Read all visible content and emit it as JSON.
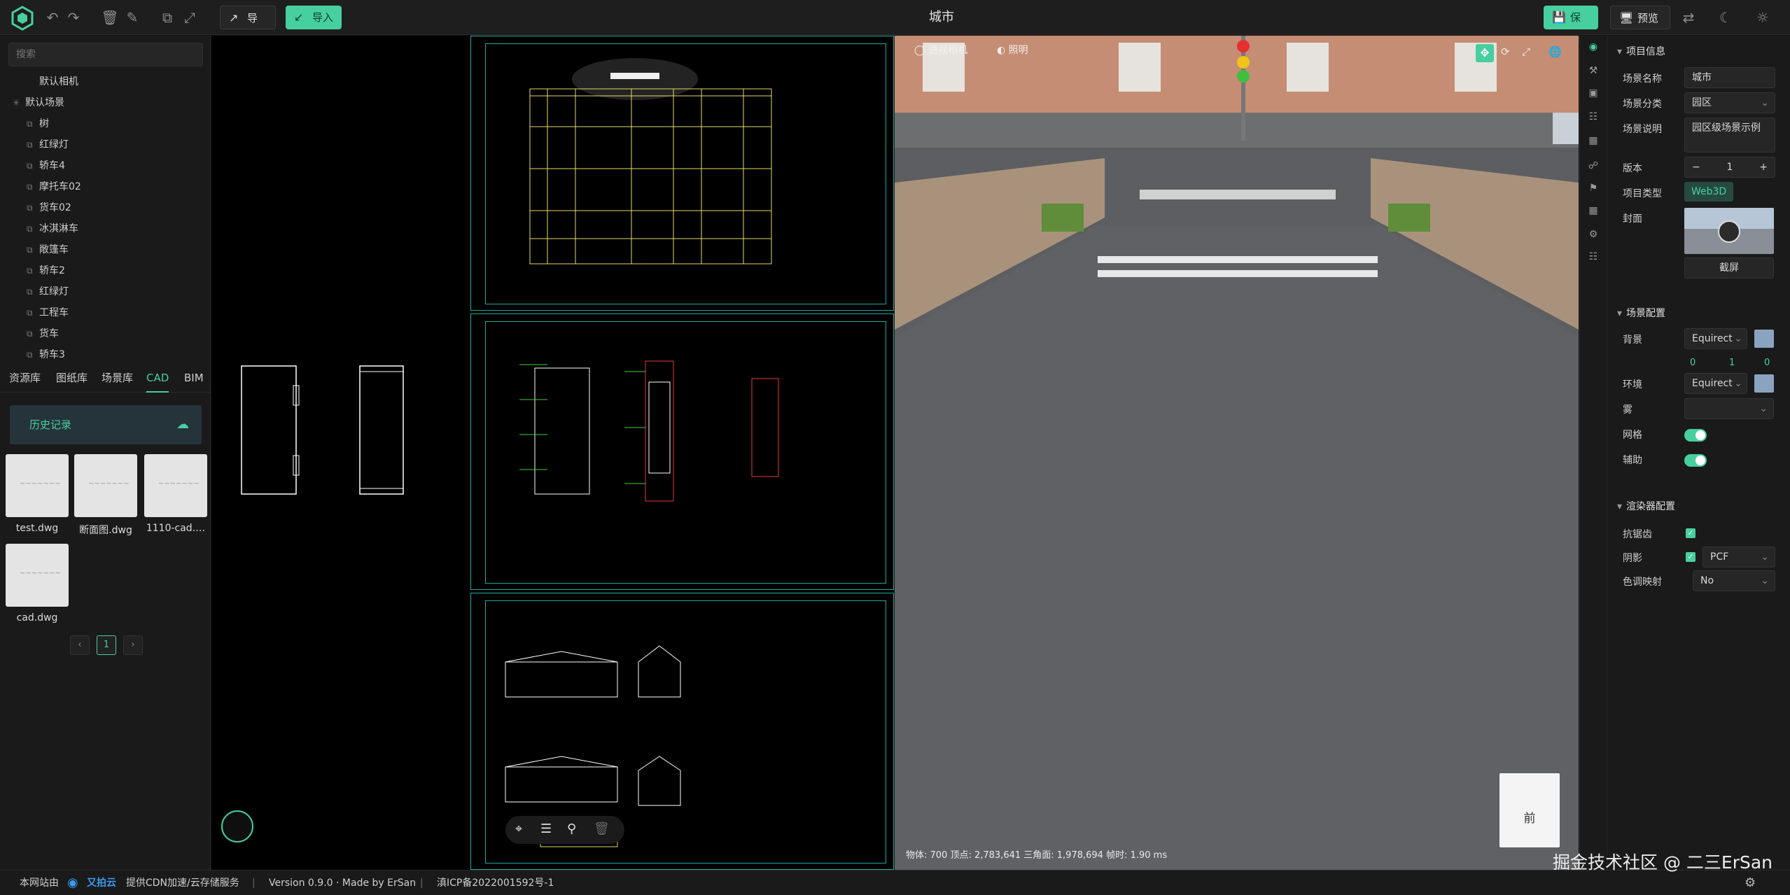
{
  "toolbar": {
    "export_label": "导出",
    "import_label": "导入",
    "title": "城市",
    "save_label": "保存",
    "preview_label": "预览"
  },
  "left": {
    "search_placeholder": "搜索",
    "tree": [
      "默认相机",
      "默认场景",
      "树",
      "红绿灯",
      "轿车4",
      "摩托车02",
      "货车02",
      "冰淇淋车",
      "敞篷车",
      "轿车2",
      "红绿灯",
      "工程车",
      "货车",
      "轿车3"
    ],
    "tabs": [
      "资源库",
      "图纸库",
      "场景库",
      "CAD",
      "BIM"
    ],
    "active_tab": "CAD",
    "history_label": "历史记录",
    "files": [
      "test.dwg",
      "断面图.dwg",
      "1110-cad.…",
      "cad.dwg"
    ],
    "page": "1"
  },
  "viewport": {
    "camera_label": "透视相机",
    "light_label": "照明",
    "status": "物体: 700  顶点: 2,783,641  三角面: 1,978,694  帧时: 1.90 ms",
    "cube_face": "前"
  },
  "right": {
    "section_project": "项目信息",
    "scene_name_label": "场景名称",
    "scene_name": "城市",
    "scene_cat_label": "场景分类",
    "scene_cat": "园区",
    "scene_desc_label": "场景说明",
    "scene_desc": "园区级场景示例",
    "version_label": "版本",
    "version": "1",
    "type_label": "项目类型",
    "type": "Web3D",
    "cover_label": "封面",
    "screenshot_label": "截屏",
    "section_scene": "场景配置",
    "bg_label": "背景",
    "bg_value": "Equirect",
    "bg_nums": [
      "0",
      "1",
      "0"
    ],
    "env_label": "环境",
    "env_value": "Equirect",
    "fog_label": "雾",
    "grid_label": "网格",
    "helper_label": "辅助",
    "section_render": "渲染器配置",
    "aa_label": "抗锯齿",
    "shadow_label": "阴影",
    "shadow_value": "PCF",
    "tonemap_label": "色调映射",
    "tonemap_value": "No"
  },
  "footer": {
    "site": "本网站由",
    "brand": "又拍云",
    "cdn": "提供CDN加速/云存储服务",
    "version": "Version 0.9.0 · Made by ErSan",
    "icp": "滇ICP备2022001592号-1"
  },
  "watermark": "掘金技术社区 @ 二三ErSan",
  "colors": {
    "accent": "#48cfa0",
    "cad_line": "#1fa9a0"
  }
}
